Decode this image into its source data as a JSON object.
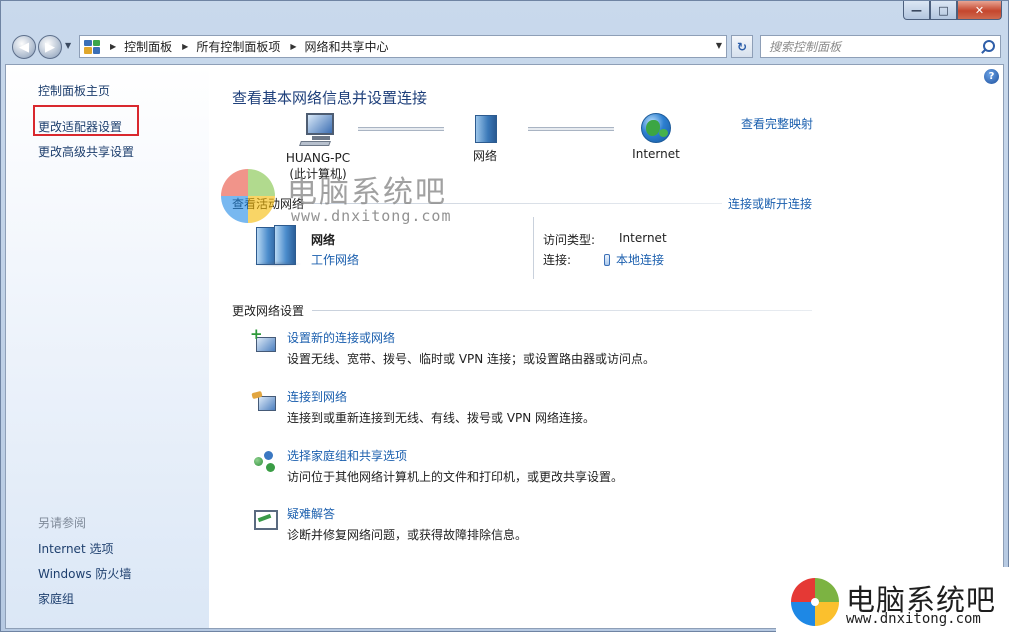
{
  "window": {
    "caption_min": "—",
    "caption_max": "□",
    "caption_close": "✕"
  },
  "nav": {
    "back_icon": "arrow-left-icon",
    "forward_icon": "arrow-right-icon"
  },
  "address": {
    "crumbs": [
      "控制面板",
      "所有控制面板项",
      "网络和共享中心"
    ]
  },
  "search": {
    "placeholder": "搜索控制面板"
  },
  "sidebar": {
    "items": [
      {
        "label": "控制面板主页"
      },
      {
        "label": "更改适配器设置"
      },
      {
        "label": "更改高级共享设置"
      }
    ],
    "see_also_heading": "另请参阅",
    "see_also": [
      {
        "label": "Internet 选项"
      },
      {
        "label": "Windows 防火墙"
      },
      {
        "label": "家庭组"
      }
    ]
  },
  "main": {
    "title": "查看基本网络信息并设置连接",
    "full_map_link": "查看完整映射",
    "map": {
      "pc_name": "HUANG-PC",
      "pc_sub": "(此计算机)",
      "network": "网络",
      "internet": "Internet"
    },
    "active_heading": "查看活动网络",
    "connect_disconnect": "连接或断开连接",
    "active": {
      "name": "网络",
      "type": "工作网络",
      "access_label": "访问类型:",
      "access_value": "Internet",
      "conn_label": "连接:",
      "conn_value": "本地连接"
    },
    "change_heading": "更改网络设置",
    "tasks": [
      {
        "title": "设置新的连接或网络",
        "desc": "设置无线、宽带、拨号、临时或 VPN 连接；或设置路由器或访问点。"
      },
      {
        "title": "连接到网络",
        "desc": "连接到或重新连接到无线、有线、拨号或 VPN 网络连接。"
      },
      {
        "title": "选择家庭组和共享选项",
        "desc": "访问位于其他网络计算机上的文件和打印机，或更改共享设置。"
      },
      {
        "title": "疑难解答",
        "desc": "诊断并修复网络问题，或获得故障排除信息。"
      }
    ]
  },
  "watermark": {
    "title": "电脑系统吧",
    "url": "www.dnxitong.com"
  },
  "colors": {
    "link": "#1b5fae",
    "highlight_box": "#d9282e",
    "title": "#1e3f7a"
  }
}
